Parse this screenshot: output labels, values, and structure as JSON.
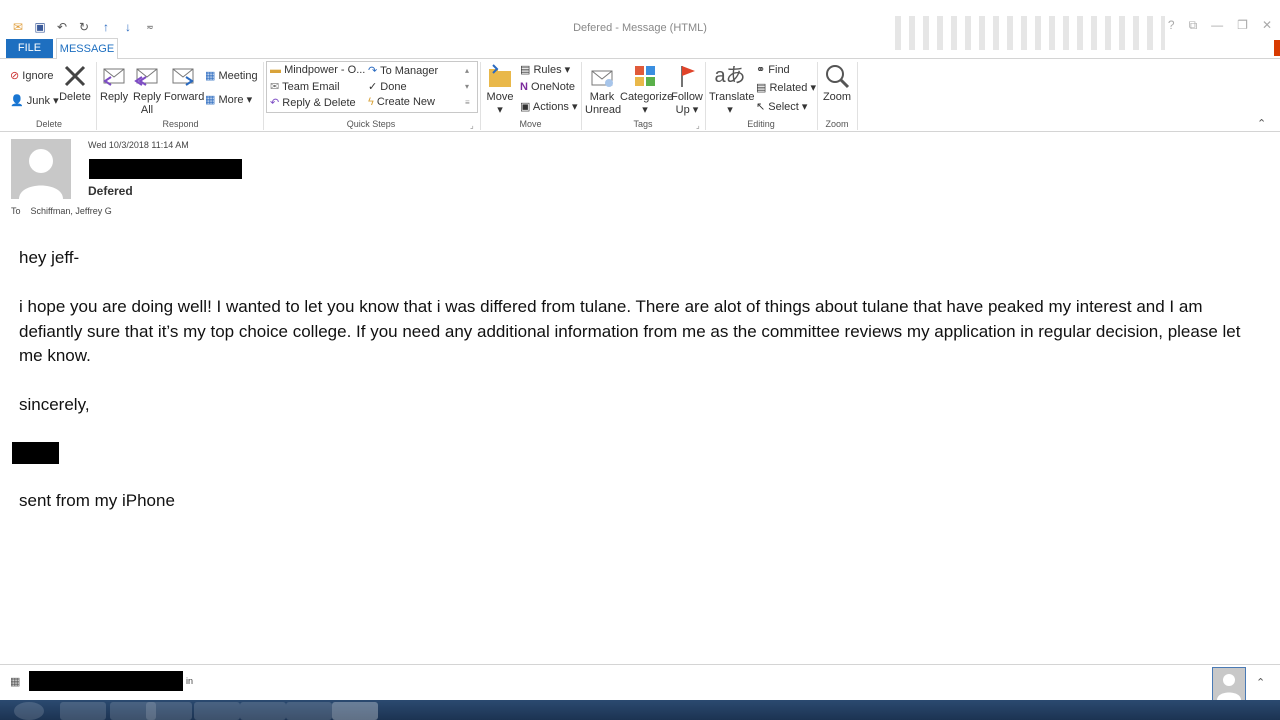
{
  "window": {
    "title": "Defered  - Message (HTML)"
  },
  "tabs": {
    "file": "FILE",
    "message": "MESSAGE"
  },
  "ribbon": {
    "delete_group": {
      "ignore": "Ignore",
      "junk": "Junk",
      "delete": "Delete",
      "label": "Delete"
    },
    "respond_group": {
      "reply": "Reply",
      "reply_all_1": "Reply",
      "reply_all_2": "All",
      "forward": "Forward",
      "meeting": "Meeting",
      "more": "More",
      "label": "Respond"
    },
    "quick_steps": {
      "items": [
        "Mindpower - O...",
        "Team Email",
        "Reply & Delete",
        "To Manager",
        "Done",
        "Create New"
      ],
      "label": "Quick Steps"
    },
    "move_group": {
      "move": "Move",
      "rules": "Rules",
      "onenote": "OneNote",
      "actions": "Actions",
      "label": "Move"
    },
    "tags_group": {
      "mark_unread_1": "Mark",
      "mark_unread_2": "Unread",
      "categorize": "Categorize",
      "follow_up_1": "Follow",
      "follow_up_2": "Up",
      "label": "Tags"
    },
    "editing_group": {
      "translate": "Translate",
      "find": "Find",
      "related": "Related",
      "select": "Select",
      "label": "Editing"
    },
    "zoom_group": {
      "zoom": "Zoom",
      "label": "Zoom"
    }
  },
  "message": {
    "date": "Wed 10/3/2018 11:14 AM",
    "subject": "Defered",
    "to_label": "To",
    "to": "Schiffman, Jeffrey G",
    "body": [
      "hey jeff-",
      "i hope you are doing well! I wanted to let you know that i was differed from tulane. There are alot of things about tulane that have peaked my interest and I am defiantly sure that it’s my top choice college. If you need any additional information from me as the committee reviews my application in regular decision, please let me know.",
      "sincerely,",
      "sent from my iPhone"
    ]
  },
  "footer": {
    "suffix": "in"
  }
}
